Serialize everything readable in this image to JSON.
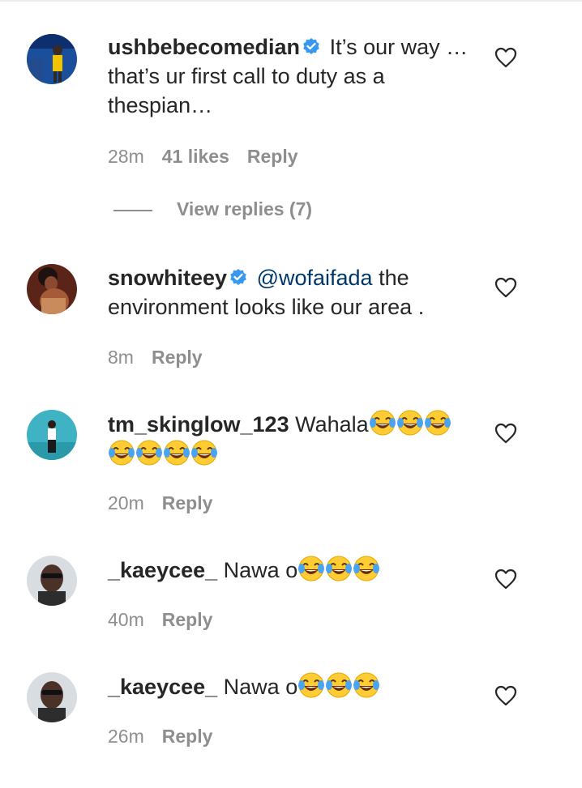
{
  "comments": [
    {
      "username": "ushbebecomedian",
      "verified": true,
      "text": "It’s our way … that’s ur first call to duty as a thespian…",
      "time": "28m",
      "likes": "41 likes",
      "reply": "Reply",
      "view_replies": "View replies (7)"
    },
    {
      "username": "snowhiteey",
      "verified": true,
      "mention": "@wofaifada",
      "text": " the environment looks like our area .",
      "time": "8m",
      "reply": "Reply"
    },
    {
      "username": "tm_skinglow_123",
      "verified": false,
      "text": "Wahala",
      "emoji_count": 7,
      "emoji": "face-with-tears-of-joy",
      "time": "20m",
      "reply": "Reply"
    },
    {
      "username": "_kaeycee_",
      "verified": false,
      "text": "Nawa o",
      "emoji_count": 3,
      "emoji": "face-with-tears-of-joy",
      "time": "40m",
      "reply": "Reply"
    },
    {
      "username": "_kaeycee_",
      "verified": false,
      "text": "Nawa o",
      "emoji_count": 3,
      "emoji": "face-with-tears-of-joy",
      "time": "26m",
      "reply": "Reply"
    }
  ],
  "colors": {
    "text": "#262626",
    "secondary": "#8e8e8e",
    "mention": "#00376b",
    "verified": "#3897f0"
  }
}
